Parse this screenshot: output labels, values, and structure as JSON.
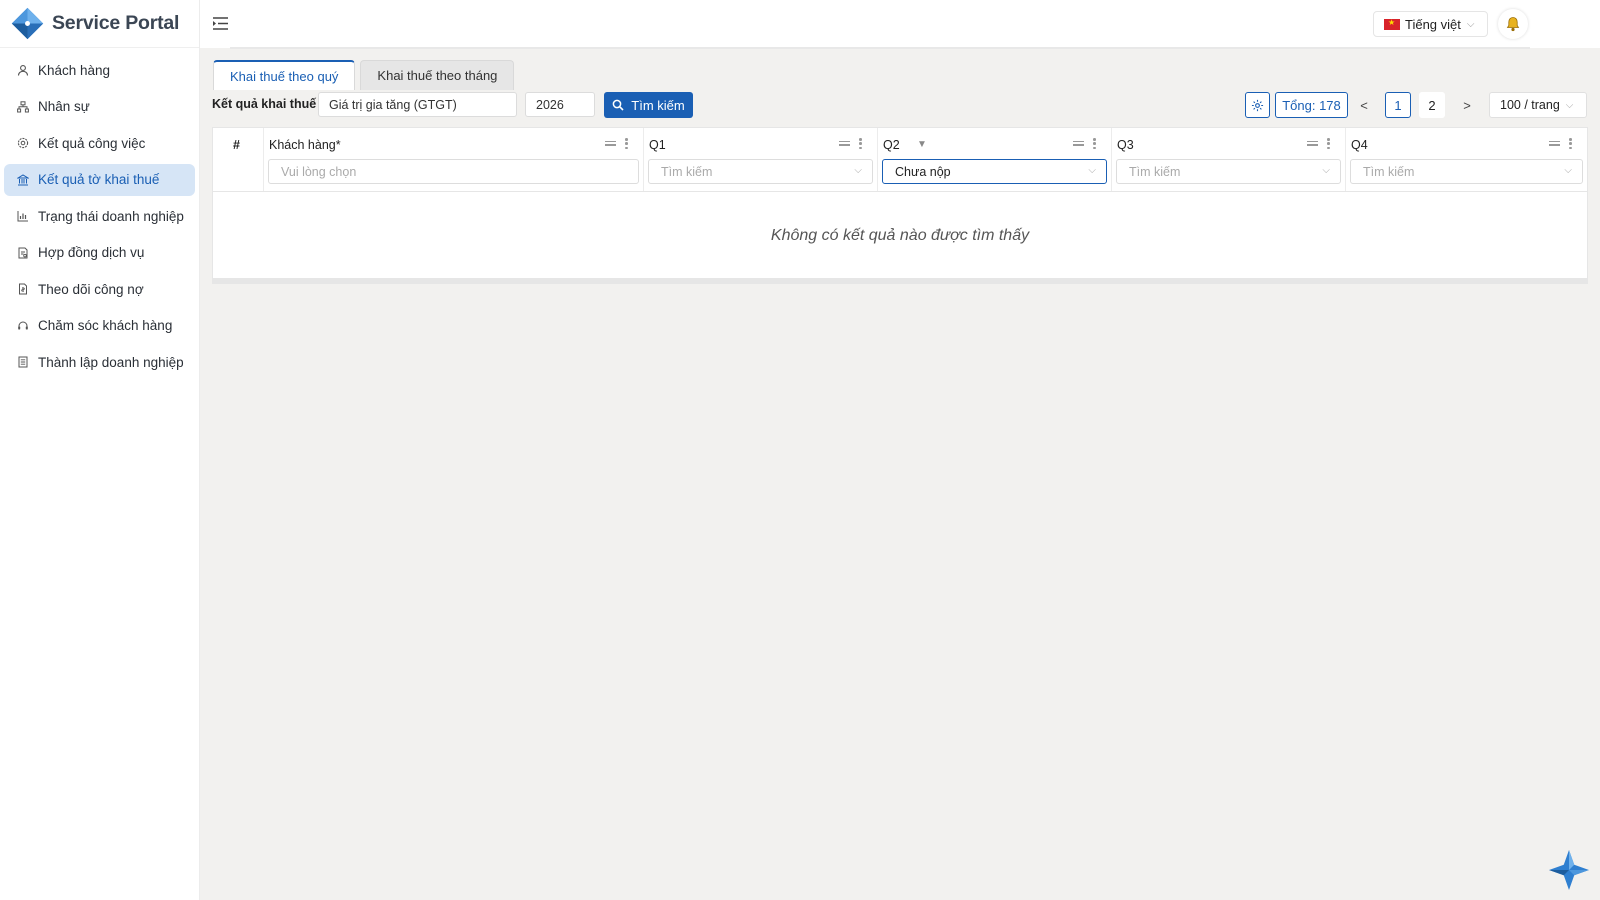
{
  "brand": {
    "name": "Service Portal"
  },
  "sidebar": {
    "items": [
      {
        "label": "Khách hàng",
        "icon": "user-icon",
        "active": false
      },
      {
        "label": "Nhân sự",
        "icon": "org-chart-icon",
        "active": false
      },
      {
        "label": "Kết quả công việc",
        "icon": "cog-badge-icon",
        "active": false
      },
      {
        "label": "Kết quả tờ khai thuế",
        "icon": "bank-icon",
        "active": true
      },
      {
        "label": "Trạng thái doanh nghiệp",
        "icon": "bar-chart-icon",
        "active": false
      },
      {
        "label": "Hợp đồng dịch vụ",
        "icon": "contract-icon",
        "active": false
      },
      {
        "label": "Theo dõi công nợ",
        "icon": "invoice-icon",
        "active": false
      },
      {
        "label": "Chăm sóc khách hàng",
        "icon": "support-icon",
        "active": false
      },
      {
        "label": "Thành lập doanh nghiệp",
        "icon": "document-list-icon",
        "active": false
      }
    ]
  },
  "header": {
    "language": "Tiếng việt",
    "language_flag": "vietnam-flag-icon",
    "notification_icon": "bell-icon"
  },
  "tabs": [
    {
      "label": "Khai thuế theo quý",
      "active": true
    },
    {
      "label": "Khai thuế theo tháng",
      "active": false
    }
  ],
  "filters": {
    "label": "Kết quả khai thuế",
    "tax_type": "Giá trị gia tăng (GTGT)",
    "year": "2026",
    "search_button": "Tìm kiếm"
  },
  "pagination": {
    "total": "Tổng: 178",
    "pages": [
      "1",
      "2"
    ],
    "current_page": "1",
    "prev": "<",
    "next": ">",
    "page_size": "100 / trang"
  },
  "table": {
    "index_header": "#",
    "columns": [
      {
        "title": "Khách hàng*",
        "filter_placeholder": "Vui lòng chọn",
        "filter_value": ""
      },
      {
        "title": "Q1",
        "filter_placeholder": "Tìm kiếm",
        "filter_value": ""
      },
      {
        "title": "Q2",
        "filter_placeholder": "Tìm kiếm",
        "filter_value": "Chưa nộp",
        "filtered": true
      },
      {
        "title": "Q3",
        "filter_placeholder": "Tìm kiếm",
        "filter_value": ""
      },
      {
        "title": "Q4",
        "filter_placeholder": "Tìm kiếm",
        "filter_value": ""
      }
    ],
    "empty_message": "Không có kết quả nào được tìm thấy"
  },
  "colors": {
    "primary": "#1a5fb4",
    "sidebar_active_bg": "#d6e5f6",
    "page_bg": "#f2f1ef"
  }
}
